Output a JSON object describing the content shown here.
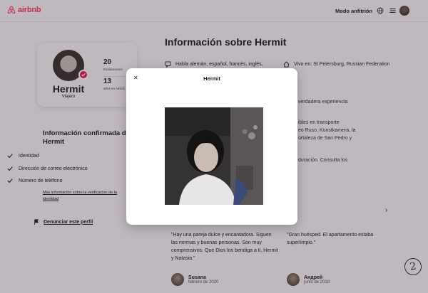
{
  "header": {
    "logo_text": "airbnb",
    "host_link": "Modo anfitrión"
  },
  "profile": {
    "name": "Hermit",
    "role": "Viajero",
    "reviews_count": "20",
    "reviews_label": "Evaluaciones",
    "years_count": "13",
    "years_label": "años en Airbnb"
  },
  "verified": {
    "title_line1": "Información confirmada de",
    "title_line2": "Hermit",
    "items": [
      "Identidad",
      "Dirección de correo electrónico",
      "Número de teléfono"
    ],
    "link_line1": "Más información sobre la verificación de la",
    "link_line2": "identidad"
  },
  "report_label": "Denunciar este perfil",
  "main": {
    "title": "Información sobre Hermit",
    "languages": "Habla alemán, español, francés, inglés,",
    "lives_in": "Vivo en: St Petersburg, Russian Federation",
    "text_1": "verdadera experiencia",
    "text_2_line1": "ibles en transporte",
    "text_2_line2": "eo Ruso, Kunstkamera, la",
    "text_2_line3": "ortaleza de San Pedro y",
    "text_3": "duración. Consulta los"
  },
  "reviews": [
    {
      "quote": "\"Hay una pareja dulce y encantadora. Siguen las normas y buenas personas. Son muy comprensivos. Que Dios los bendiga a ti, Hermit y Natasia.\"",
      "name": "Susana",
      "date": "febrero de 2020"
    },
    {
      "quote": "\"Gran huésped. El apartamento estaba superlimpio.\"",
      "name": "Андрей",
      "date": "junio de 2018"
    }
  ],
  "page_number": "2",
  "modal": {
    "title": "Hermit",
    "close_icon": "close-icon"
  },
  "colors": {
    "brand": "#ff385c",
    "badge": "#e51d53",
    "overlay": "rgba(40,20,40,0.28)"
  }
}
